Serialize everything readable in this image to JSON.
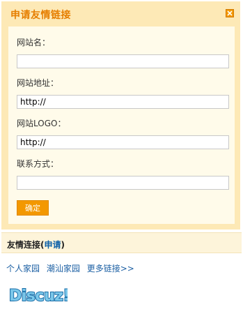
{
  "dialog": {
    "title": "申请友情链接",
    "close_icon": "close-icon",
    "fields": [
      {
        "label": "网站名：",
        "value": "",
        "placeholder": ""
      },
      {
        "label": "网站地址：",
        "value": "http://",
        "placeholder": ""
      },
      {
        "label": "网站LOGO：",
        "value": "http://",
        "placeholder": ""
      },
      {
        "label": "联系方式：",
        "value": "",
        "placeholder": ""
      }
    ],
    "submit_label": "确定"
  },
  "links": {
    "header_prefix": "友情连接(",
    "apply_link": "申请",
    "header_suffix": ")",
    "items": [
      "个人家园",
      "潮汕家园",
      "更多链接>>"
    ]
  },
  "logo_text": "Discuz!",
  "colors": {
    "accent": "#f39800",
    "title": "#e67e00",
    "link": "#1b5fa3",
    "dialog_bg": "#fde9b6"
  }
}
